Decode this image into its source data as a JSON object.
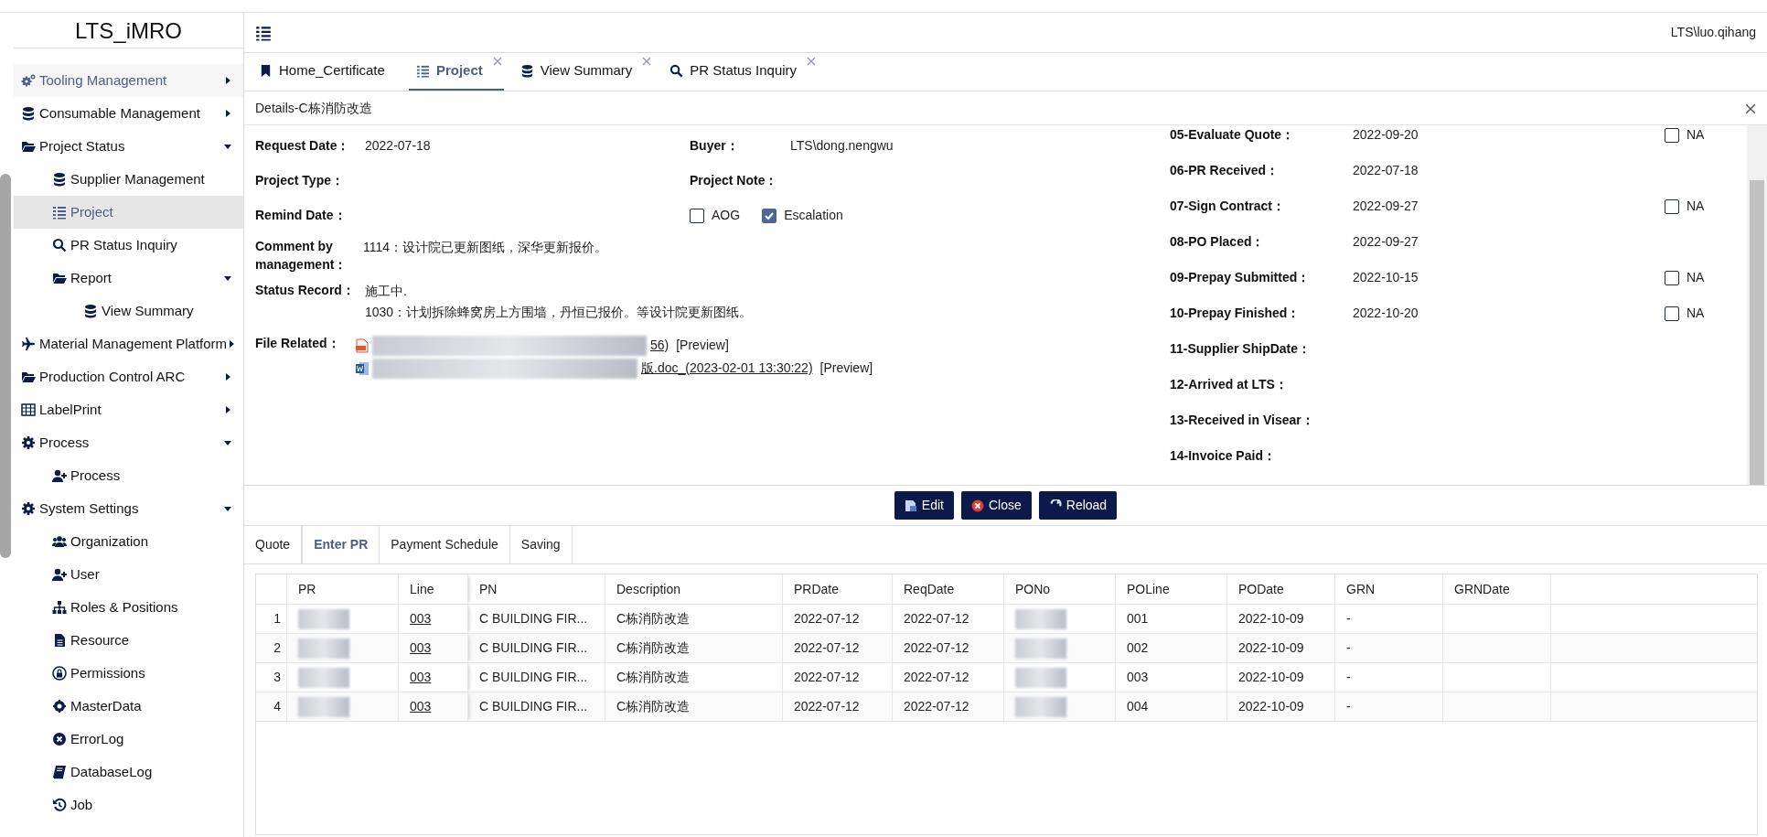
{
  "app": {
    "logo": "LTS_iMRO",
    "user": "LTS\\luo.qihang"
  },
  "sidebar": {
    "items": [
      {
        "label": "Tooling Management",
        "selected": false,
        "hovered": true,
        "expanded": false
      },
      {
        "label": "Consumable Management",
        "selected": false,
        "hovered": false,
        "expanded": false
      },
      {
        "label": "Project Status",
        "selected": false,
        "hovered": false,
        "expanded": true,
        "children": [
          {
            "label": "Supplier Management",
            "selected": false,
            "hovered": false
          },
          {
            "label": "Project",
            "selected": true,
            "hovered": false
          },
          {
            "label": "PR Status Inquiry",
            "selected": false,
            "hovered": false
          },
          {
            "label": "Report",
            "selected": false,
            "hovered": false,
            "expanded": true,
            "children": [
              {
                "label": "View Summary",
                "selected": false,
                "hovered": false
              }
            ]
          }
        ]
      },
      {
        "label": "Material Management Platform",
        "selected": false,
        "hovered": false,
        "expanded": false
      },
      {
        "label": "Production Control ARC",
        "selected": false,
        "hovered": false,
        "expanded": false
      },
      {
        "label": "LabelPrint",
        "selected": false,
        "hovered": false,
        "expanded": false
      },
      {
        "label": "Process",
        "selected": false,
        "hovered": false,
        "expanded": true,
        "children": [
          {
            "label": "Process",
            "selected": false,
            "hovered": false
          }
        ]
      },
      {
        "label": "System Settings",
        "selected": false,
        "hovered": false,
        "expanded": true,
        "children": [
          {
            "label": "Organization",
            "selected": false,
            "hovered": false
          },
          {
            "label": "User",
            "selected": false,
            "hovered": false
          },
          {
            "label": "Roles & Positions",
            "selected": false,
            "hovered": false
          },
          {
            "label": "Resource",
            "selected": false,
            "hovered": false
          },
          {
            "label": "Permissions",
            "selected": false,
            "hovered": false
          },
          {
            "label": "MasterData",
            "selected": false,
            "hovered": false
          },
          {
            "label": "ErrorLog",
            "selected": false,
            "hovered": false
          },
          {
            "label": "DatabaseLog",
            "selected": false,
            "hovered": false
          },
          {
            "label": "Job",
            "selected": false,
            "hovered": false
          }
        ]
      }
    ]
  },
  "tabs": [
    {
      "label": "Home_Certificate",
      "selected": false,
      "closable": false
    },
    {
      "label": "Project",
      "selected": true,
      "closable": true
    },
    {
      "label": "View Summary",
      "selected": false,
      "closable": true
    },
    {
      "label": "PR Status Inquiry",
      "selected": false,
      "closable": true
    }
  ],
  "details": {
    "title": "Details-C栋消防改造",
    "rows": [
      {
        "label": "Request Date：",
        "value": "2022-07-18",
        "label2": "Buyer：",
        "value2": "LTS\\dong.nengwu"
      },
      {
        "label": "Project Type：",
        "label2": "Project Note："
      },
      {
        "label": "Remind Date：",
        "checks": [
          {
            "label": "AOG",
            "checked": false
          },
          {
            "label": "Escalation",
            "checked": true
          }
        ]
      }
    ],
    "comment": {
      "label": "Comment by management：",
      "lines": [
        "1114：设计院已更新图纸，深华更新报价。"
      ]
    },
    "status": {
      "label": "Status Record：",
      "lines": [
        "施工中.",
        "1030：计划拆除蜂窝房上方围墙，丹恒已报价。等设计院更新图纸。"
      ]
    },
    "files": {
      "label": "File Related：",
      "items": [
        {
          "kind": "pdf",
          "name_tail": "56)",
          "preview": "[Preview]"
        },
        {
          "kind": "word",
          "name_tail": "版.doc_(2023-02-01 13:30:22)",
          "preview": "[Preview]"
        }
      ]
    },
    "milestones": [
      {
        "label": "05-Evaluate Quote：",
        "value": "2022-09-20",
        "na": {
          "label": "NA",
          "checked": false
        }
      },
      {
        "label": "06-PR Received：",
        "value": "2022-07-18"
      },
      {
        "label": "07-Sign Contract：",
        "value": "2022-09-27",
        "na": {
          "label": "NA",
          "checked": false
        }
      },
      {
        "label": "08-PO Placed：",
        "value": "2022-09-27"
      },
      {
        "label": "09-Prepay Submitted：",
        "value": "2022-10-15",
        "na": {
          "label": "NA",
          "checked": false
        }
      },
      {
        "label": "10-Prepay Finished：",
        "value": "2022-10-20",
        "na": {
          "label": "NA",
          "checked": false
        }
      },
      {
        "label": "11-Supplier ShipDate："
      },
      {
        "label": "12-Arrived at LTS："
      },
      {
        "label": "13-Received in Visear："
      },
      {
        "label": "14-Invoice Paid："
      }
    ]
  },
  "actions": [
    {
      "label": "Edit",
      "kind": "edit"
    },
    {
      "label": "Close",
      "kind": "close"
    },
    {
      "label": "Reload",
      "kind": "reload"
    }
  ],
  "subtabs": [
    {
      "label": "Quote",
      "selected": false
    },
    {
      "label": "Enter PR",
      "selected": true
    },
    {
      "label": "Payment Schedule",
      "selected": false
    },
    {
      "label": "Saving",
      "selected": false
    }
  ],
  "table": {
    "columns": [
      "PR",
      "Line",
      "PN",
      "Description",
      "PRDate",
      "ReqDate",
      "PONo",
      "POLine",
      "PODate",
      "GRN",
      "GRNDate"
    ],
    "rows": [
      {
        "index": "1",
        "pr_redacted": true,
        "line": "003",
        "pn": "C BUILDING FIR...",
        "description": "C栋消防改造",
        "prdate": "2022-07-12",
        "reqdate": "2022-07-12",
        "pono_redacted": true,
        "poline": "001",
        "podate": "2022-10-09",
        "grn": "-"
      },
      {
        "index": "2",
        "pr_redacted": true,
        "line": "003",
        "pn": "C BUILDING FIR...",
        "description": "C栋消防改造",
        "prdate": "2022-07-12",
        "reqdate": "2022-07-12",
        "pono_redacted": true,
        "poline": "002",
        "podate": "2022-10-09",
        "grn": "-"
      },
      {
        "index": "3",
        "pr_redacted": true,
        "line": "003",
        "pn": "C BUILDING FIR...",
        "description": "C栋消防改造",
        "prdate": "2022-07-12",
        "reqdate": "2022-07-12",
        "pono_redacted": true,
        "poline": "003",
        "podate": "2022-10-09",
        "grn": "-"
      },
      {
        "index": "4",
        "pr_redacted": true,
        "line": "003",
        "pn": "C BUILDING FIR...",
        "description": "C栋消防改造",
        "prdate": "2022-07-12",
        "reqdate": "2022-07-12",
        "pono_redacted": true,
        "poline": "004",
        "podate": "2022-10-09",
        "grn": "-"
      }
    ]
  }
}
